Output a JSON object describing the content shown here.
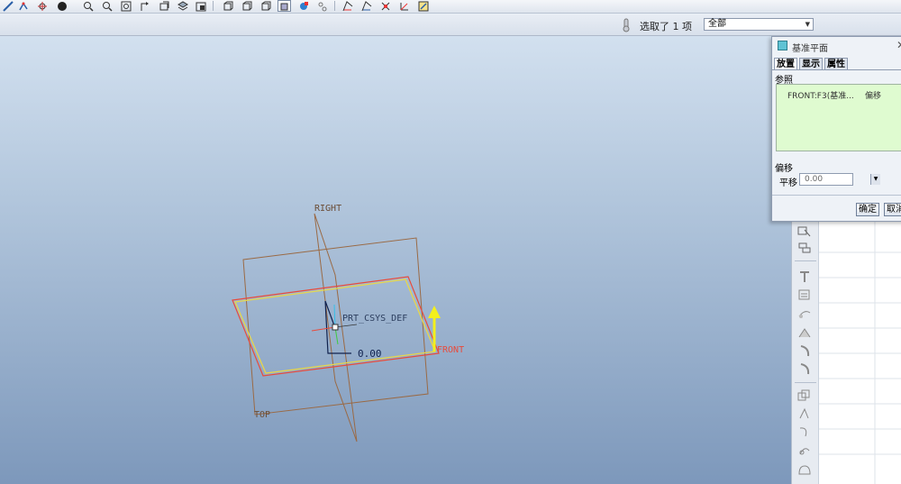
{
  "toolbar": {
    "buttons": [
      "repaint-icon",
      "wireframe-icon",
      "spin-center-icon",
      "appearance-icon",
      "zoom-in-icon",
      "zoom-out-icon",
      "refit-icon",
      "reorient-icon",
      "saved-views-icon",
      "layers-icon",
      "view-manager-icon",
      "shading-icon",
      "hidden-line-icon",
      "no-hidden-icon",
      "wireframe-display-icon",
      "datum-display-icon",
      "annotation-icon",
      "plane-display-icon",
      "axis-display-icon",
      "point-display-icon",
      "csys-display-icon"
    ]
  },
  "status": {
    "selected_text": "选取了 1 项",
    "filter_value": "全部"
  },
  "viewport": {
    "plane_labels": {
      "right": "RIGHT",
      "front": "FRONT",
      "top": "TOP"
    },
    "csys_label": "PRT_CSYS_DEF",
    "offset_value": "0.00",
    "colors": {
      "preview_plane": "#e8d64a",
      "highlight": "#e84b3c",
      "datum": "#9a6a45",
      "arrow": "#f3f01c"
    }
  },
  "dialog": {
    "title": "基准平面",
    "tabs": [
      "放置",
      "显示",
      "属性"
    ],
    "references_label": "参照",
    "reference_item": "FRONT:F3(基准...",
    "reference_type": "偏移",
    "offset_label": "偏移",
    "translate_label": "平移",
    "translate_value": "0.00",
    "ok_label": "确定",
    "cancel_label": "取消"
  }
}
